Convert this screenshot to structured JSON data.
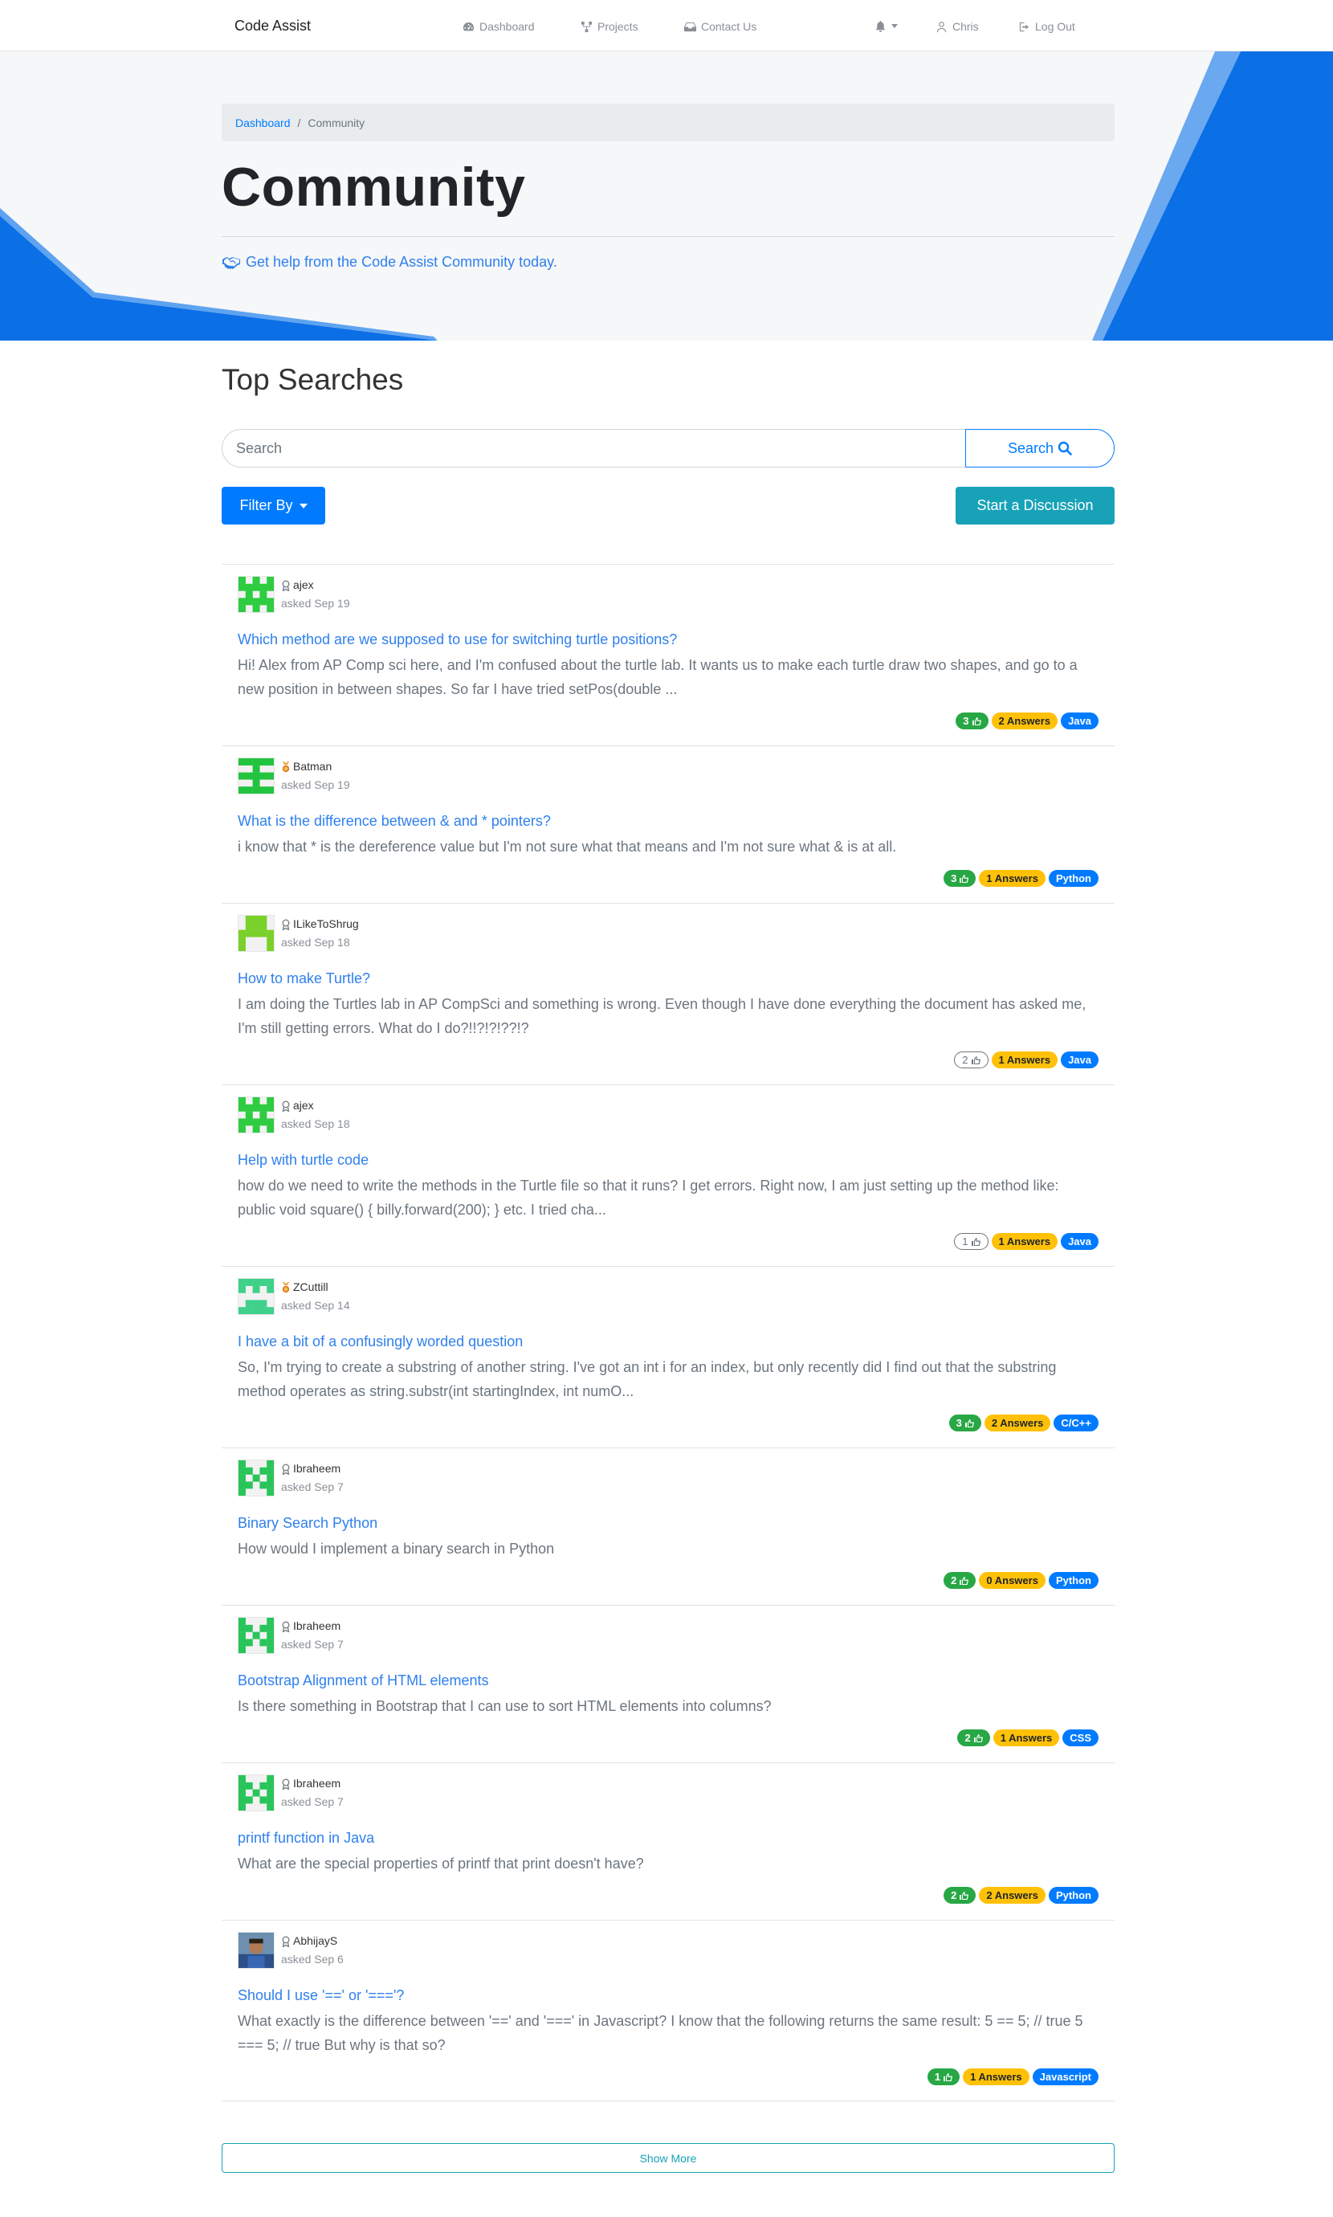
{
  "navbar": {
    "brand": "Code Assist",
    "links": [
      {
        "label": "Dashboard",
        "icon": "dashboard-icon"
      },
      {
        "label": "Projects",
        "icon": "projects-icon"
      },
      {
        "label": "Contact Us",
        "icon": "inbox-icon"
      }
    ],
    "user": "Chris",
    "logout": "Log Out"
  },
  "breadcrumb": {
    "home": "Dashboard",
    "separator": "/",
    "current": "Community"
  },
  "hero": {
    "title": "Community",
    "subtitle": "Get help from the Code Assist Community today."
  },
  "search": {
    "heading": "Top Searches",
    "placeholder": "Search",
    "button": "Search",
    "filter": "Filter By",
    "start": "Start a Discussion"
  },
  "discussions": [
    {
      "user": "ajex",
      "asked": "asked Sep 19",
      "title": "Which method are we supposed to use for switching turtle positions?",
      "body": "Hi! Alex from AP Comp sci here, and I'm confused about the turtle lab. It wants us to make each turtle draw two shapes, and go to a new position in between shapes. So far I have tried setPos(double ...",
      "votes": "3",
      "answers": "2 Answers",
      "tag": "Java"
    },
    {
      "user": "Batman",
      "asked": "asked Sep 19",
      "title": "What is the difference between & and * pointers?",
      "body": "i know that * is the dereference value but I'm not sure what that means and I'm not sure what & is at all.",
      "votes": "3",
      "answers": "1 Answers",
      "tag": "Python"
    },
    {
      "user": "ILikeToShrug",
      "asked": "asked Sep 18",
      "title": "How to make Turtle?",
      "body": "I am doing the Turtles lab in AP CompSci and something is wrong. Even though I have done everything the document has asked me, I'm still getting errors. What do I do?!!?!?!??!?",
      "votes": "2",
      "answers": "1 Answers",
      "tag": "Java"
    },
    {
      "user": "ajex",
      "asked": "asked Sep 18",
      "title": "Help with turtle code",
      "body": "how do we need to write the methods in the Turtle file so that it runs? I get errors. Right now, I am just setting up the method like: public void square() { billy.forward(200); } etc. I tried cha...",
      "votes": "1",
      "answers": "1 Answers",
      "tag": "Java"
    },
    {
      "user": "ZCuttill",
      "asked": "asked Sep 14",
      "title": "I have a bit of a confusingly worded question",
      "body": "So, I'm trying to create a substring of another string. I've got an int i for an index, but only recently did I find out that the substring method operates as string.substr(int startingIndex, int numO...",
      "votes": "3",
      "answers": "2 Answers",
      "tag": "C/C++"
    },
    {
      "user": "Ibraheem",
      "asked": "asked Sep 7",
      "title": "Binary Search Python",
      "body": "How would I implement a binary search in Python",
      "votes": "2",
      "answers": "0 Answers",
      "tag": "Python"
    },
    {
      "user": "Ibraheem",
      "asked": "asked Sep 7",
      "title": "Bootstrap Alignment of HTML elements",
      "body": "Is there something in Bootstrap that I can use to sort HTML elements into columns?",
      "votes": "2",
      "answers": "1 Answers",
      "tag": "CSS"
    },
    {
      "user": "Ibraheem",
      "asked": "asked Sep 7",
      "title": "printf function in Java",
      "body": "What are the special properties of printf that print doesn't have?",
      "votes": "2",
      "answers": "2 Answers",
      "tag": "Python"
    },
    {
      "user": "AbhijayS",
      "asked": "asked Sep 6",
      "title": "Should I use '==' or '==='?",
      "body": "What exactly is the difference between '==' and '===' in Javascript? I know that the following returns the same result: 5 == 5; // true 5 === 5; // true But why is that so?",
      "votes": "1",
      "answers": "1 Answers",
      "tag": "Javascript"
    }
  ],
  "show_more": "Show More",
  "colors": {
    "primary": "#007bff",
    "info": "#17a2b8",
    "success": "#28a745",
    "warning": "#ffc107",
    "hero_blue": "#0b6fe6"
  }
}
